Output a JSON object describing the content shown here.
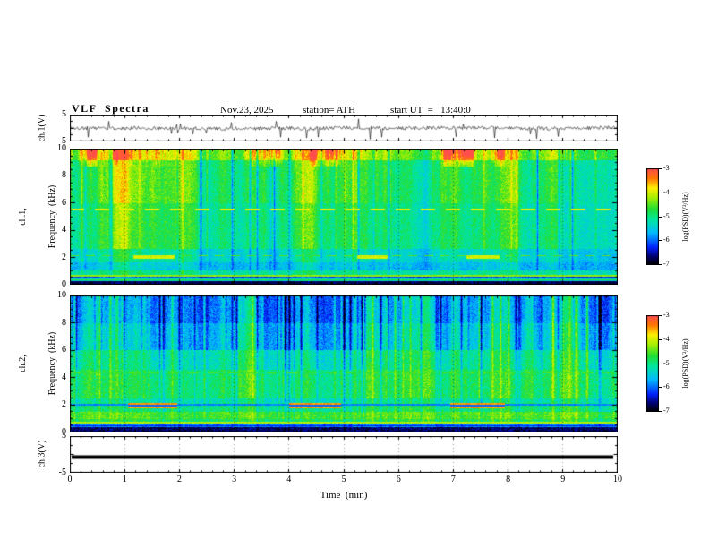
{
  "header": {
    "title": "VLF  Spectra",
    "date": "Nov.23, 2025",
    "station": "station= ATH",
    "start_ut": "start UT  =   13:40:0"
  },
  "xaxis": {
    "label": "Time  (min)",
    "range": [
      0,
      10
    ],
    "ticks": [
      0,
      1,
      2,
      3,
      4,
      5,
      6,
      7,
      8,
      9,
      10
    ]
  },
  "panels": {
    "ch1_waveform": {
      "ylabel": "ch.1(V)",
      "yrange": [
        -5,
        5
      ],
      "yticks": [
        5,
        -5
      ]
    },
    "ch1_spectrogram": {
      "ylabel_line1": "ch.1,",
      "ylabel_line2": "Frequency  (kHz)",
      "yrange": [
        0,
        10
      ],
      "yticks": [
        10,
        8,
        6,
        4,
        2,
        0
      ]
    },
    "ch2_spectrogram": {
      "ylabel_line1": "ch.2,",
      "ylabel_line2": "Frequency  (kHz)",
      "yrange": [
        0,
        10
      ],
      "yticks": [
        10,
        8,
        6,
        4,
        2,
        0
      ]
    },
    "ch3_waveform": {
      "ylabel": "ch.3(V)",
      "yrange": [
        -5,
        5
      ],
      "yticks": [
        5,
        -5
      ],
      "signal_value": -0.85
    }
  },
  "colorbar": {
    "label": "log(PSD)(V²/Hz)",
    "range": [
      -7,
      -3
    ],
    "ticks": [
      -3,
      -4,
      -5,
      -6,
      -7
    ],
    "stops": [
      {
        "t": 0.0,
        "color": "#000000"
      },
      {
        "t": 0.08,
        "color": "#000066"
      },
      {
        "t": 0.18,
        "color": "#0020ff"
      },
      {
        "t": 0.33,
        "color": "#00baff"
      },
      {
        "t": 0.47,
        "color": "#00e8a0"
      },
      {
        "t": 0.58,
        "color": "#22dd33"
      },
      {
        "t": 0.7,
        "color": "#a8f000"
      },
      {
        "t": 0.8,
        "color": "#ffee00"
      },
      {
        "t": 0.9,
        "color": "#ff7700"
      },
      {
        "t": 1.0,
        "color": "#ff4d4d"
      }
    ]
  },
  "chart_data": [
    {
      "name": "ch1_waveform",
      "type": "line",
      "title": "ch.1 voltage trace",
      "xlabel": "Time (min)",
      "ylabel": "ch.1(V)",
      "xlim": [
        0,
        10
      ],
      "ylim": [
        -5,
        5
      ],
      "description": "Broadband noise band of roughly ±1 V around 0 V with many impulsive sferic spikes reaching toward ±5 V across the full 10 minutes",
      "seed": 11,
      "noise_amp": 0.65,
      "spike_prob": 0.05,
      "spike_amp": [
        1.0,
        4.3
      ],
      "down_bias": 0.6
    },
    {
      "name": "ch1_spectrogram",
      "type": "heatmap",
      "title": "ch.1 dynamic spectrum",
      "xlabel": "Time (min)",
      "ylabel": "Frequency (kHz)",
      "xlim": [
        0,
        10
      ],
      "ylim": [
        0,
        10
      ],
      "zlim": [
        -7,
        -3
      ],
      "zlabel": "log(PSD)(V²/Hz)",
      "description": "Green background near -5 log(PSD); red/orange enhancement above ~9 kHz; dark-blue vertical sferic streaks; dashed hum line at 5.5 kHz; yellow-green bursts near 2 kHz; dark bands below 1 kHz; nearly black strip at 0 kHz",
      "seed": 7,
      "grain": 0.55,
      "streaks": {
        "dark_prob": 0.05,
        "dark_amp": [
          1.2,
          3.0
        ],
        "bright_prob": 0.035,
        "bright_amp": [
          0.7,
          1.6
        ]
      },
      "top_patch": {
        "fmin": 8.7,
        "amp": 2.0
      },
      "bands": [
        [
          9.2,
          10.01,
          -4.35,
          0.9
        ],
        [
          6.0,
          9.2,
          -4.85,
          0.8
        ],
        [
          2.6,
          6.0,
          -5.0,
          0.65
        ],
        [
          1.6,
          2.6,
          -5.35,
          0.5
        ],
        [
          1.05,
          1.6,
          -5.6,
          0.35
        ],
        [
          0.72,
          1.05,
          -5.15,
          0.3
        ],
        [
          0.45,
          0.72,
          -6.1,
          0.2
        ],
        [
          0.22,
          0.45,
          -5.4,
          0.2
        ],
        [
          0.0,
          0.22,
          -6.75,
          0.08
        ]
      ],
      "hlines": [
        [
          5.52,
          0.07,
          -3.9,
          16,
          12
        ],
        [
          2.12,
          0.05,
          -4.5,
          10,
          8
        ],
        [
          0.62,
          0.05,
          -4.3,
          1,
          0
        ],
        [
          0.33,
          0.04,
          -4.7,
          1,
          0
        ]
      ],
      "segments": [
        {
          "f": 2.0,
          "hw": 0.12,
          "v": -4.0,
          "ranges": [
            [
              1.15,
              1.9
            ],
            [
              5.25,
              5.8
            ],
            [
              7.25,
              7.85
            ]
          ]
        }
      ]
    },
    {
      "name": "ch2_spectrogram",
      "type": "heatmap",
      "title": "ch.2 dynamic spectrum",
      "xlabel": "Time (min)",
      "ylabel": "Frequency (kHz)",
      "xlim": [
        0,
        10
      ],
      "ylim": [
        0,
        10
      ],
      "zlim": [
        -7,
        -3
      ],
      "zlabel": "log(PSD)(V²/Hz)",
      "description": "Blue/dark upper band above ~6 kHz with dense vertical streaks; green mid band 2.5-6 kHz; strong red-brown burst segments near 2 kHz at ~1-2, 4-5 and 7-8 min; yellow-green bands near 0.7-1.5 kHz; nearly black strip at 0 kHz",
      "seed": 23,
      "grain": 0.6,
      "streaks": {
        "dark_prob": 0.06,
        "dark_amp": [
          0.8,
          2.2
        ],
        "bright_prob": 0.05,
        "bright_amp": [
          0.8,
          1.8
        ]
      },
      "bands": [
        [
          8.0,
          10.01,
          -5.75,
          1.0
        ],
        [
          6.0,
          8.0,
          -5.5,
          0.95
        ],
        [
          4.6,
          6.0,
          -5.1,
          0.7
        ],
        [
          2.5,
          4.6,
          -4.85,
          0.55
        ],
        [
          2.15,
          2.5,
          -5.15,
          0.45
        ],
        [
          1.5,
          2.15,
          -4.95,
          0.4
        ],
        [
          0.95,
          1.5,
          -4.55,
          0.3
        ],
        [
          0.6,
          0.95,
          -4.8,
          0.3
        ],
        [
          0.35,
          0.6,
          -5.9,
          0.2
        ],
        [
          0.0,
          0.35,
          -6.7,
          0.08
        ]
      ],
      "hlines": [
        [
          4.35,
          0.05,
          -4.55,
          12,
          10
        ],
        [
          2.0,
          0.04,
          -5.9,
          1,
          0
        ],
        [
          0.68,
          0.05,
          -4.15,
          1,
          0
        ],
        [
          0.45,
          0.04,
          -6.3,
          1,
          0
        ]
      ],
      "segments": [
        {
          "f": 1.95,
          "hw": 0.2,
          "v": -3.5,
          "core_hw": 0.05,
          "core_v": -6.0,
          "ranges": [
            [
              1.05,
              1.95
            ],
            [
              4.0,
              4.95
            ],
            [
              6.95,
              7.95
            ]
          ]
        }
      ]
    },
    {
      "name": "ch3_waveform",
      "type": "line",
      "title": "ch.3 voltage trace",
      "xlabel": "Time (min)",
      "ylabel": "ch.3(V)",
      "xlim": [
        0,
        10
      ],
      "ylim": [
        -5,
        5
      ],
      "description": "Flat constant trace (dead channel) drawn as a thick black horizontal bar slightly below 0 V",
      "constant_value": -0.85,
      "line_width": 4
    }
  ]
}
